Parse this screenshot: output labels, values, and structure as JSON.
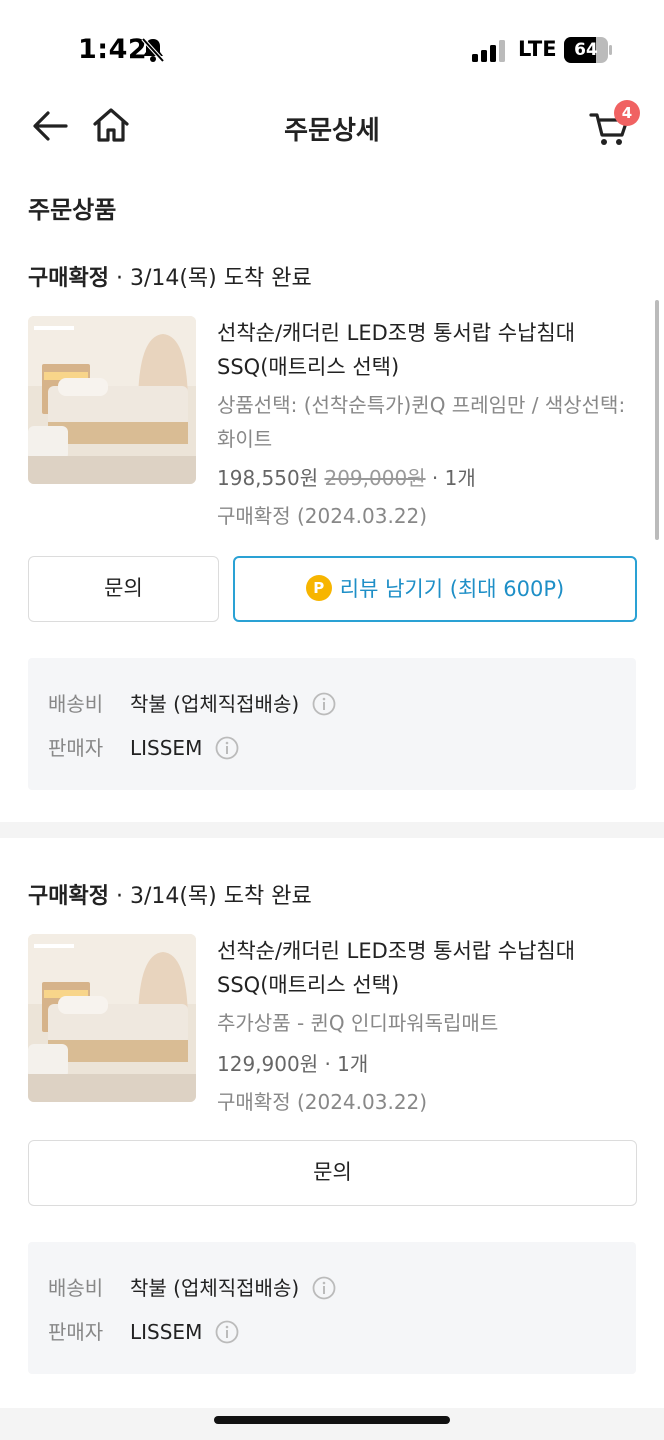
{
  "status_bar": {
    "time": "1:42",
    "network": "LTE",
    "battery": "64"
  },
  "header": {
    "title": "주문상세",
    "cart_count": "4"
  },
  "section": {
    "title": "주문상품"
  },
  "orders": [
    {
      "status_bold": "구매확정",
      "status_rest": " · 3/14(목) 도착 완료",
      "name": "선착순/캐더린 LED조명 통서랍 수납침대 SSQ(매트리스 선택)",
      "option": "상품선택: (선착순특가)퀸Q 프레임만 / 색상선택: 화이트",
      "price": "198,550원",
      "original_price": "209,000원",
      "qty": " · 1개",
      "confirm": "구매확정 (2024.03.22)",
      "inquiry_label": "문의",
      "review_label": "리뷰 남기기 (최대 600P)",
      "point_symbol": "P",
      "shipping_label": "배송비",
      "shipping_value": "착불 (업체직접배송)",
      "seller_label": "판매자",
      "seller_value": "LISSEM"
    },
    {
      "status_bold": "구매확정",
      "status_rest": " · 3/14(목) 도착 완료",
      "name": "선착순/캐더린 LED조명 통서랍 수납침대 SSQ(매트리스 선택)",
      "option": "추가상품 - 퀸Q 인디파워독립매트",
      "price": "129,900원",
      "qty": " · 1개",
      "confirm": "구매확정 (2024.03.22)",
      "inquiry_label": "문의",
      "shipping_label": "배송비",
      "shipping_value": "착불 (업체직접배송)",
      "seller_label": "판매자",
      "seller_value": "LISSEM"
    }
  ],
  "colors": {
    "accent": "#2aa1d4",
    "badge": "#f06262",
    "point": "#f7b500",
    "info_bg": "#f5f6f8"
  }
}
